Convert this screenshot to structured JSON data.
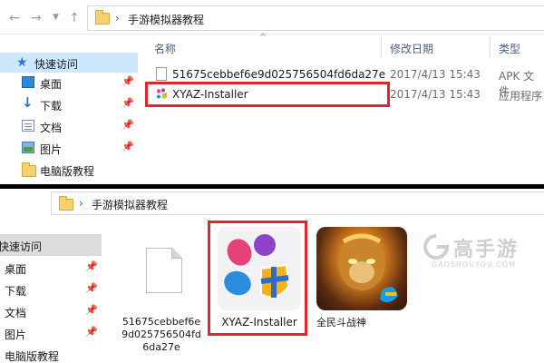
{
  "top": {
    "nav": {
      "back": "←",
      "forward": "→"
    },
    "breadcrumb": [
      "手游模拟器教程"
    ],
    "sidebar": [
      {
        "label": "快速访问",
        "pinned": false,
        "selected": true
      },
      {
        "label": "桌面",
        "pinned": true
      },
      {
        "label": "下载",
        "pinned": true
      },
      {
        "label": "文档",
        "pinned": true
      },
      {
        "label": "图片",
        "pinned": true
      },
      {
        "label": "电脑版教程",
        "pinned": false
      }
    ],
    "columns": {
      "name": "名称",
      "date": "修改日期",
      "type": "类型"
    },
    "files": [
      {
        "name": "51675cebbef6e9d025756504fd6da27e",
        "date": "2017/4/13 15:43",
        "type": "APK 文件"
      },
      {
        "name": "XYAZ-Installer",
        "date": "2017/4/13 15:43",
        "type": "应用程序"
      }
    ]
  },
  "bottom": {
    "breadcrumb": [
      "手游模拟器教程"
    ],
    "sidebar": [
      {
        "label": "快速访问",
        "selected": true
      },
      {
        "label": "桌面",
        "pinned": true
      },
      {
        "label": "下载",
        "pinned": true
      },
      {
        "label": "文档",
        "pinned": true
      },
      {
        "label": "图片",
        "pinned": true
      },
      {
        "label": "电脑版教程"
      }
    ],
    "tiles": {
      "file_name_lines": [
        "51675cebbef6e",
        "9d025756504fd",
        "6da27e"
      ],
      "installer": "XYAZ-Installer",
      "game": "全民斗战神"
    }
  },
  "watermark": {
    "brand": "高手游",
    "domain": "GAOSHOUYOU.COM"
  },
  "icons": {
    "nav": [
      "back-arrow-icon",
      "forward-arrow-icon",
      "dropdown-icon",
      "up-arrow-icon"
    ],
    "sidebar": [
      "star-icon",
      "desktop-icon",
      "download-icon",
      "document-icon",
      "picture-icon",
      "folder-icon",
      "pin-icon"
    ]
  },
  "colors": {
    "highlight": "#e0262d",
    "selected": "#cce8ff",
    "folder": "#f4d26b",
    "accent": "#2b79d6"
  }
}
